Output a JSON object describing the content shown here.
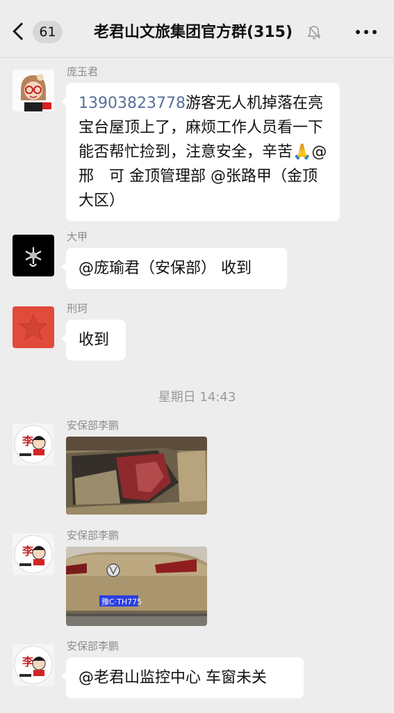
{
  "nav": {
    "unread_count": "61",
    "title": "老君山文旅集团官方群(315)",
    "icons": {
      "back": "chevron-left-icon",
      "muted": "bell-off-icon",
      "more": "more-dots-icon"
    }
  },
  "messages": [
    {
      "sender": "庞玉君",
      "phone": "13903823778",
      "text": "游客无人机掉落在亮宝台屋顶上了，麻烦工作人员看一下能否帮忙捡到，注意安全，辛苦🙏@邢　可 金顶管理部 @张路甲（金顶大区）"
    },
    {
      "sender": "大甲",
      "text": "@庞瑜君（安保部） 收到"
    },
    {
      "sender": "刑珂",
      "text": "收到"
    },
    {
      "divider": "星期日 14:43"
    },
    {
      "sender": "安保部李鹏",
      "image": "car-interior-photo"
    },
    {
      "sender": "安保部李鹏",
      "image": "car-rear-photo",
      "plate": "豫C·TH775"
    },
    {
      "sender": "安保部李鹏",
      "text": "@老君山监控中心 车窗未关"
    }
  ],
  "avatar_text": {
    "li_peng": "李"
  }
}
